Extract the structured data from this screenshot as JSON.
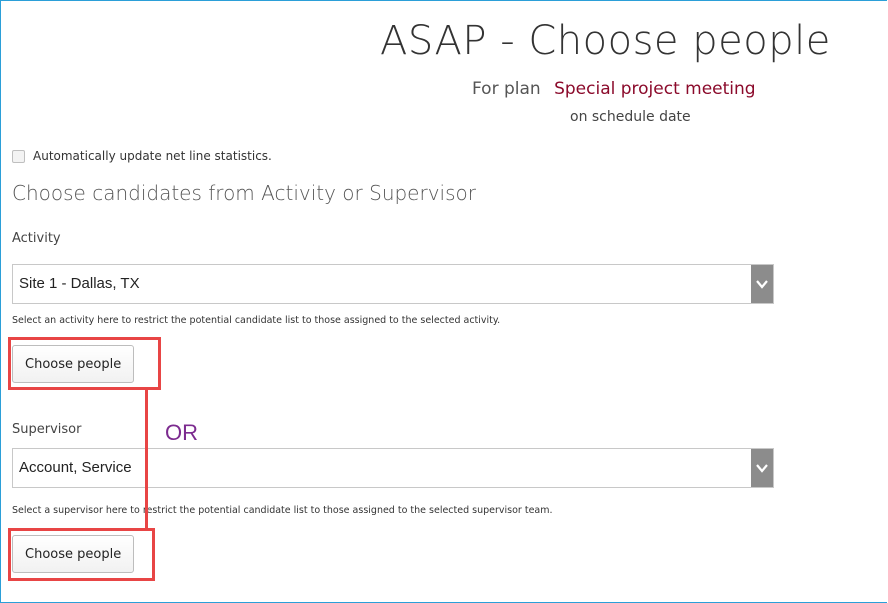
{
  "header": {
    "title": "ASAP - Choose people",
    "plan_prefix": "For plan",
    "plan_name": "Special project meeting",
    "schedule_text": "on schedule date"
  },
  "options": {
    "auto_update_label": "Automatically update net line statistics.",
    "auto_update_checked": false
  },
  "section": {
    "heading": "Choose candidates from Activity or Supervisor"
  },
  "activity": {
    "label": "Activity",
    "selected": "Site 1 - Dallas, TX",
    "help": "Select an activity here to restrict the potential candidate list to those assigned to the selected activity.",
    "button_label": "Choose people"
  },
  "annotation": {
    "or_text": "OR",
    "highlight_color": "#e84545",
    "or_color": "#7c2b8f"
  },
  "supervisor": {
    "label": "Supervisor",
    "selected": "Account, Service",
    "help": "Select a supervisor here to restrict the potential candidate list to those assigned to the selected supervisor team.",
    "button_label": "Choose people"
  },
  "icons": {
    "dropdown": "chevron-down-icon"
  },
  "colors": {
    "frame_border": "#2b9fd8",
    "plan_name": "#8b0a2b",
    "dropdown_button": "#8c8c8c"
  }
}
